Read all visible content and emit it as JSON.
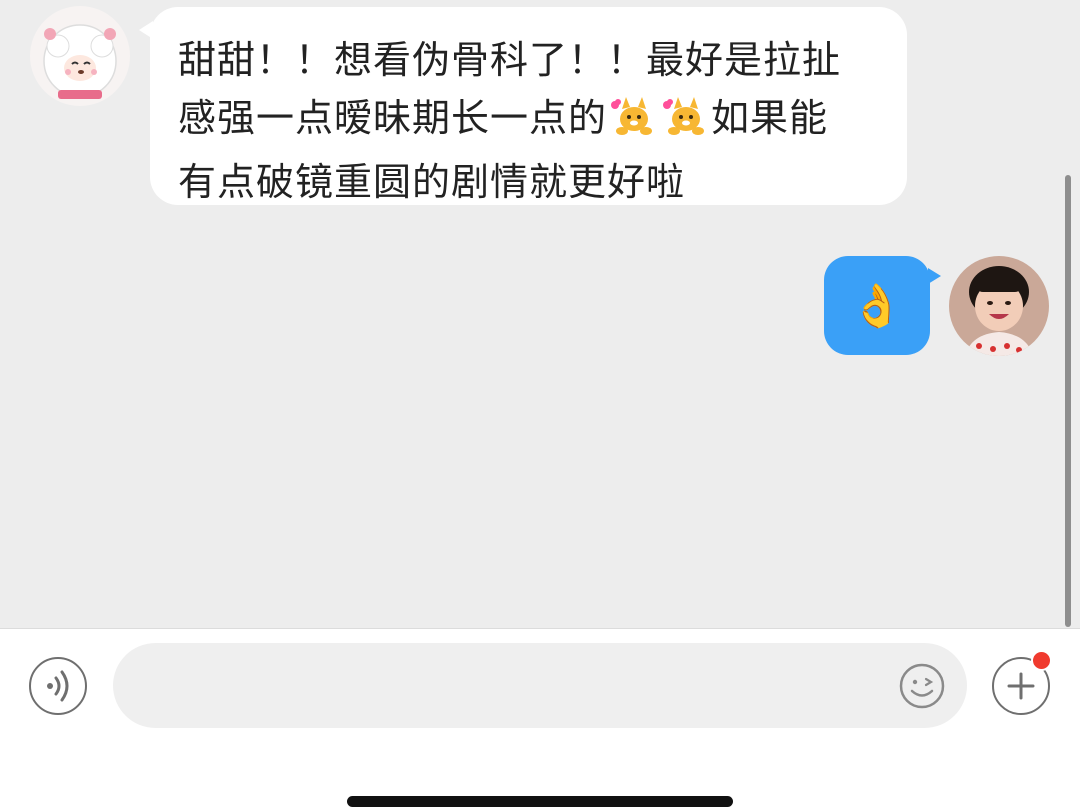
{
  "messages": [
    {
      "sender": "other",
      "lines": [
        [
          "甜甜！！想看伪骨科了！！最好是拉扯"
        ],
        [
          "感强一点暧昧期长一点的",
          "",
          "如果能"
        ],
        [
          "有点破镜重圆的剧情就更好啦"
        ]
      ],
      "sticker_icon": "dancing-dog-sticker"
    },
    {
      "sender": "self",
      "text": "👌"
    }
  ],
  "input_bar": {
    "value": "",
    "voice_icon": "voice-icon",
    "emoji_icon": "emoji-icon",
    "add_icon": "plus-icon",
    "notification_color": "#f03a2e"
  },
  "colors": {
    "self_bubble": "#3aa0f7",
    "other_bubble": "#ffffff",
    "background": "#ededed"
  }
}
